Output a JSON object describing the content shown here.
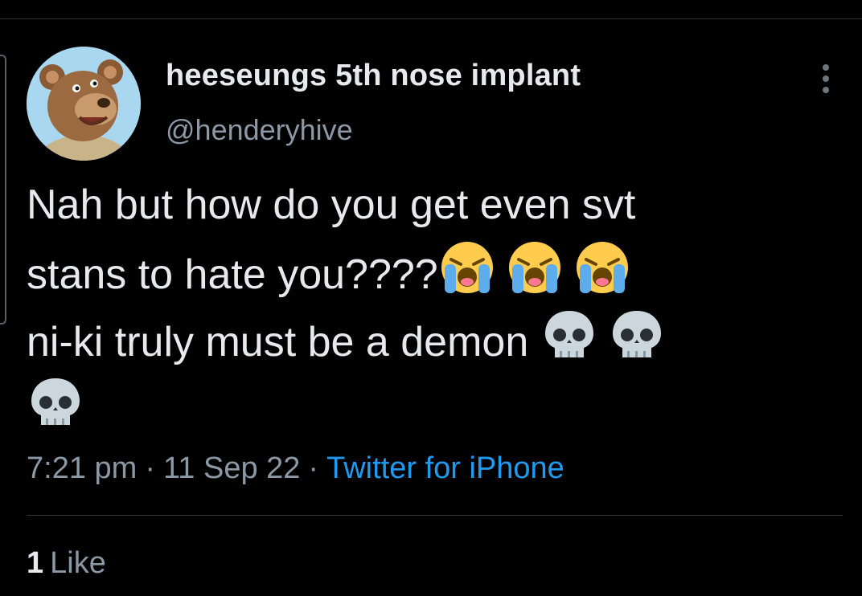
{
  "tweet": {
    "author": {
      "display_name": "heeseungs 5th nose implant",
      "handle": "@henderyhive",
      "avatar_icon": "bear-cartoon-avatar"
    },
    "text_lines": [
      "Nah but how do you get even svt",
      "stans to hate you????",
      "ni-ki truly must be a demon",
      ""
    ],
    "emoji": {
      "line2": [
        "loudly-crying-face-icon",
        "loudly-crying-face-icon",
        "loudly-crying-face-icon"
      ],
      "line3": [
        "skull-icon",
        "skull-icon"
      ],
      "line4": [
        "skull-icon"
      ]
    },
    "time": "7:21 pm",
    "separator": "·",
    "date": "11 Sep 22",
    "source": "Twitter for iPhone",
    "likes_count": "1",
    "likes_label": "Like"
  },
  "colors": {
    "background": "#000000",
    "text": "#e7e9ea",
    "secondary_text": "#8b98a5",
    "link": "#1d9bf0",
    "divider": "#2f3336"
  }
}
